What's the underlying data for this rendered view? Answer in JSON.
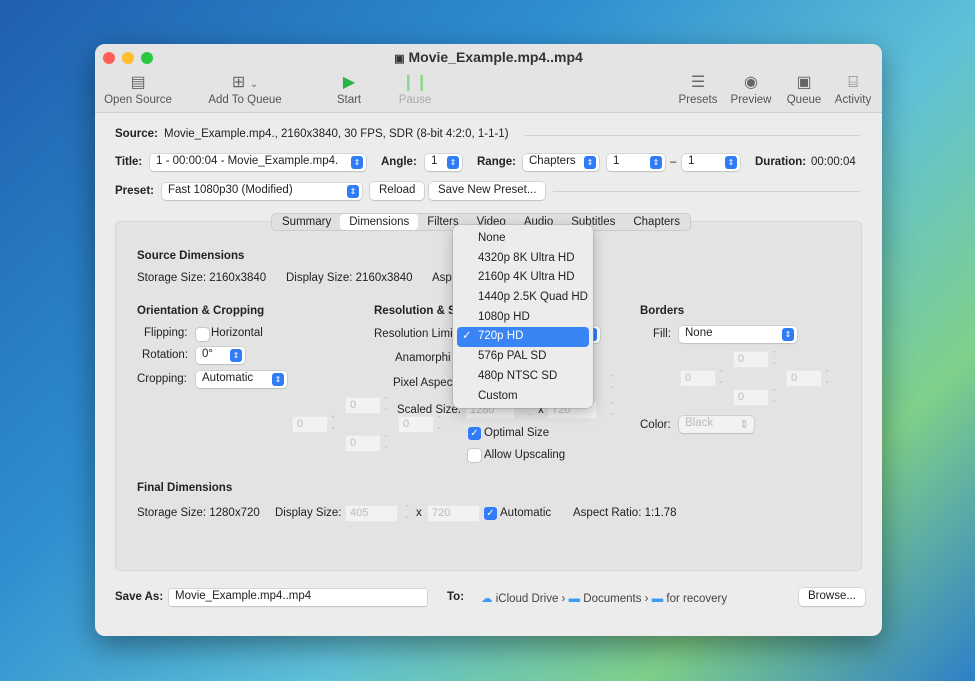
{
  "window": {
    "title": "Movie_Example.mp4..mp4"
  },
  "toolbar": {
    "open_source": "Open Source",
    "add_to_queue": "Add To Queue",
    "start": "Start",
    "pause": "Pause",
    "presets": "Presets",
    "preview": "Preview",
    "queue": "Queue",
    "activity": "Activity"
  },
  "source": {
    "label": "Source:",
    "value": "Movie_Example.mp4., 2160x3840, 30 FPS, SDR (8-bit 4:2:0, 1-1-1)"
  },
  "title_row": {
    "title_label": "Title:",
    "title_value": "1 - 00:00:04 - Movie_Example.mp4.",
    "angle_label": "Angle:",
    "angle_value": "1",
    "range_label": "Range:",
    "range_type": "Chapters",
    "range_start": "1",
    "range_sep": "–",
    "range_end": "1",
    "duration_label": "Duration:",
    "duration_value": "00:00:04"
  },
  "preset_row": {
    "label": "Preset:",
    "value": "Fast 1080p30 (Modified)",
    "reload": "Reload",
    "save_new": "Save New Preset..."
  },
  "tabs": [
    "Summary",
    "Dimensions",
    "Filters",
    "Video",
    "Audio",
    "Subtitles",
    "Chapters"
  ],
  "selected_tab": "Dimensions",
  "source_dimensions": {
    "heading": "Source Dimensions",
    "storage": "Storage Size: 2160x3840",
    "display": "Display Size: 2160x3840",
    "aspect": "Asp"
  },
  "orientation": {
    "heading": "Orientation & Cropping",
    "flipping_label": "Flipping:",
    "horizontal": "Horizontal",
    "horizontal_checked": false,
    "rotation_label": "Rotation:",
    "rotation_value": "0°",
    "cropping_label": "Cropping:",
    "cropping_value": "Automatic",
    "crop_top": "0",
    "crop_left": "0",
    "crop_right": "0",
    "crop_bottom": "0"
  },
  "resolution": {
    "heading": "Resolution & S",
    "limit_label": "Resolution Limi",
    "anamorphic_label": "Anamorphi",
    "pixel_aspect_label": "Pixel Aspec",
    "scaled_label": "Scaled Size:",
    "scaled_w": "1280",
    "x": "x",
    "scaled_h": "720",
    "optimal": "Optimal Size",
    "optimal_checked": true,
    "upscaling": "Allow Upscaling",
    "upscaling_checked": false
  },
  "resolution_menu": {
    "items": [
      "None",
      "4320p 8K Ultra HD",
      "2160p 4K Ultra HD",
      "1440p 2.5K Quad HD",
      "1080p HD",
      "720p HD",
      "576p PAL SD",
      "480p NTSC SD",
      "Custom"
    ],
    "selected": "720p HD"
  },
  "borders": {
    "heading": "Borders",
    "fill_label": "Fill:",
    "fill_value": "None",
    "top": "0",
    "left": "0",
    "right": "0",
    "bottom": "0",
    "color_label": "Color:",
    "color_value": "Black"
  },
  "final": {
    "heading": "Final Dimensions",
    "storage": "Storage Size: 1280x720",
    "display_label": "Display Size:",
    "display_w": "405",
    "x": "x",
    "display_h": "720",
    "automatic": "Automatic",
    "automatic_checked": true,
    "aspect": "Aspect Ratio:  1:1.78"
  },
  "save": {
    "label": "Save As:",
    "value": "Movie_Example.mp4..mp4",
    "to_label": "To:",
    "path": [
      "iCloud Drive",
      "Documents",
      "for recovery"
    ],
    "browse": "Browse..."
  },
  "colors": {
    "accent": "#2f7cf6",
    "close": "#ff5f57",
    "minimize": "#febc2e",
    "zoom": "#28c840",
    "start": "#28b446"
  }
}
